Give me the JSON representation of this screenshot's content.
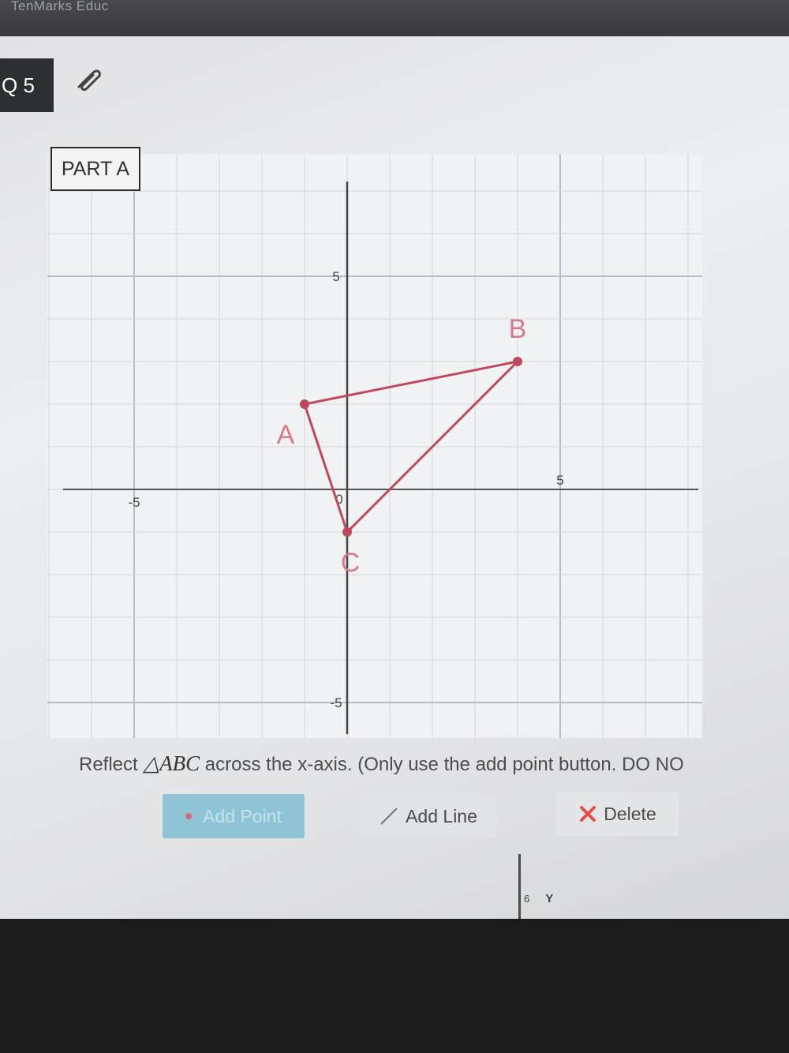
{
  "app": {
    "title_partial": "TenMarks Educ"
  },
  "question": {
    "label": "Q 5"
  },
  "part": {
    "label": "PART A"
  },
  "graph": {
    "axis_labels": {
      "x_neg": "-5",
      "x_pos": "5",
      "y_pos": "5",
      "y_neg": "-5",
      "origin": "0"
    },
    "vertices": [
      {
        "label": "A",
        "x": -1,
        "y": 2
      },
      {
        "label": "B",
        "x": 4,
        "y": 3
      },
      {
        "label": "C",
        "x": 0,
        "y": -1
      }
    ],
    "color": "#c0485e"
  },
  "instruction": {
    "prefix": "Reflect ",
    "triangle": "△ABC",
    "suffix": " across the x-axis. (Only use the add point button. DO NO"
  },
  "toolbar": {
    "add_point": "Add Point",
    "add_line": "Add Line",
    "delete": "Delete"
  },
  "bottom": {
    "num": "6",
    "letter": "Y"
  }
}
